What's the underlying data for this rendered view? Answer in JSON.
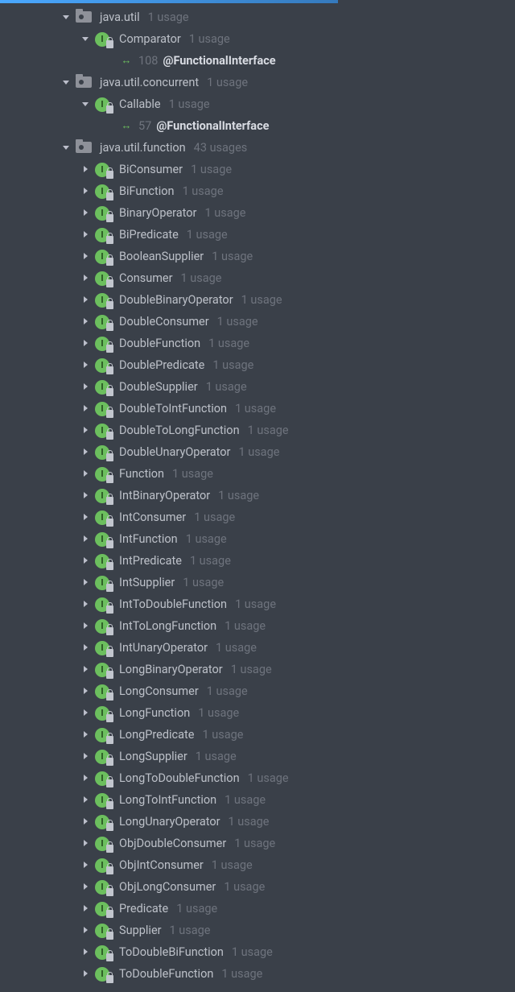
{
  "annotation_label": "@FunctionalInterface",
  "packages": [
    {
      "name": "java.util",
      "usage": "1 usage",
      "expanded": true,
      "children": [
        {
          "name": "Comparator",
          "usage": "1 usage",
          "expanded": true,
          "line": "108"
        }
      ]
    },
    {
      "name": "java.util.concurrent",
      "usage": "1 usage",
      "expanded": true,
      "children": [
        {
          "name": "Callable",
          "usage": "1 usage",
          "expanded": true,
          "line": "57"
        }
      ]
    },
    {
      "name": "java.util.function",
      "usage": "43 usages",
      "expanded": true,
      "children": [
        {
          "name": "BiConsumer",
          "usage": "1 usage",
          "expanded": false
        },
        {
          "name": "BiFunction",
          "usage": "1 usage",
          "expanded": false
        },
        {
          "name": "BinaryOperator",
          "usage": "1 usage",
          "expanded": false
        },
        {
          "name": "BiPredicate",
          "usage": "1 usage",
          "expanded": false
        },
        {
          "name": "BooleanSupplier",
          "usage": "1 usage",
          "expanded": false
        },
        {
          "name": "Consumer",
          "usage": "1 usage",
          "expanded": false
        },
        {
          "name": "DoubleBinaryOperator",
          "usage": "1 usage",
          "expanded": false
        },
        {
          "name": "DoubleConsumer",
          "usage": "1 usage",
          "expanded": false
        },
        {
          "name": "DoubleFunction",
          "usage": "1 usage",
          "expanded": false
        },
        {
          "name": "DoublePredicate",
          "usage": "1 usage",
          "expanded": false
        },
        {
          "name": "DoubleSupplier",
          "usage": "1 usage",
          "expanded": false
        },
        {
          "name": "DoubleToIntFunction",
          "usage": "1 usage",
          "expanded": false
        },
        {
          "name": "DoubleToLongFunction",
          "usage": "1 usage",
          "expanded": false
        },
        {
          "name": "DoubleUnaryOperator",
          "usage": "1 usage",
          "expanded": false
        },
        {
          "name": "Function",
          "usage": "1 usage",
          "expanded": false
        },
        {
          "name": "IntBinaryOperator",
          "usage": "1 usage",
          "expanded": false
        },
        {
          "name": "IntConsumer",
          "usage": "1 usage",
          "expanded": false
        },
        {
          "name": "IntFunction",
          "usage": "1 usage",
          "expanded": false
        },
        {
          "name": "IntPredicate",
          "usage": "1 usage",
          "expanded": false
        },
        {
          "name": "IntSupplier",
          "usage": "1 usage",
          "expanded": false
        },
        {
          "name": "IntToDoubleFunction",
          "usage": "1 usage",
          "expanded": false
        },
        {
          "name": "IntToLongFunction",
          "usage": "1 usage",
          "expanded": false
        },
        {
          "name": "IntUnaryOperator",
          "usage": "1 usage",
          "expanded": false
        },
        {
          "name": "LongBinaryOperator",
          "usage": "1 usage",
          "expanded": false
        },
        {
          "name": "LongConsumer",
          "usage": "1 usage",
          "expanded": false
        },
        {
          "name": "LongFunction",
          "usage": "1 usage",
          "expanded": false
        },
        {
          "name": "LongPredicate",
          "usage": "1 usage",
          "expanded": false
        },
        {
          "name": "LongSupplier",
          "usage": "1 usage",
          "expanded": false
        },
        {
          "name": "LongToDoubleFunction",
          "usage": "1 usage",
          "expanded": false
        },
        {
          "name": "LongToIntFunction",
          "usage": "1 usage",
          "expanded": false
        },
        {
          "name": "LongUnaryOperator",
          "usage": "1 usage",
          "expanded": false
        },
        {
          "name": "ObjDoubleConsumer",
          "usage": "1 usage",
          "expanded": false
        },
        {
          "name": "ObjIntConsumer",
          "usage": "1 usage",
          "expanded": false
        },
        {
          "name": "ObjLongConsumer",
          "usage": "1 usage",
          "expanded": false
        },
        {
          "name": "Predicate",
          "usage": "1 usage",
          "expanded": false
        },
        {
          "name": "Supplier",
          "usage": "1 usage",
          "expanded": false
        },
        {
          "name": "ToDoubleBiFunction",
          "usage": "1 usage",
          "expanded": false
        },
        {
          "name": "ToDoubleFunction",
          "usage": "1 usage",
          "expanded": false
        }
      ]
    }
  ]
}
